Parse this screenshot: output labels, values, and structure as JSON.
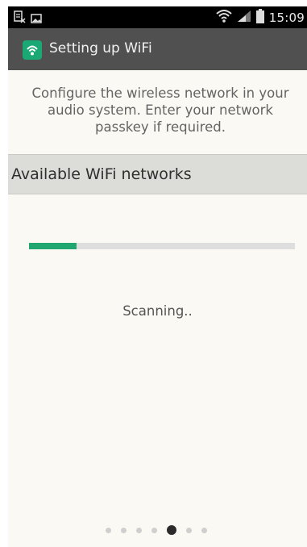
{
  "status_bar": {
    "time": "15:09",
    "icons": [
      "no-sim-icon",
      "image-icon",
      "wifi-icon",
      "signal-icon",
      "battery-icon"
    ]
  },
  "app_bar": {
    "title": "Setting up WiFi",
    "icon": "wifi-app-icon",
    "icon_color": "#1aa874"
  },
  "instructions": "Configure the wireless network in your audio system. Enter your network passkey if required.",
  "section": {
    "title": "Available WiFi networks"
  },
  "progress": {
    "value": 0.18,
    "color": "#1fa76f"
  },
  "status_text": "Scanning..",
  "pager": {
    "total": 7,
    "current_index": 4
  }
}
